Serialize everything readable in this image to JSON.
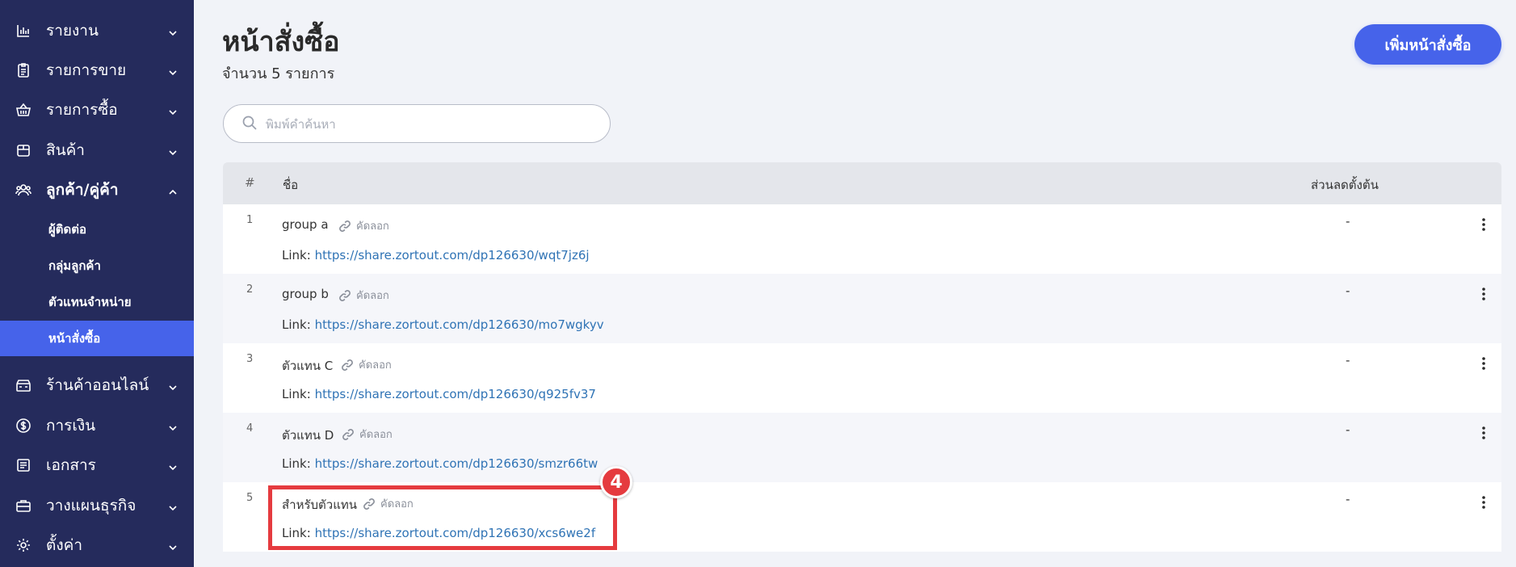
{
  "sidebar": {
    "items": [
      {
        "label": "รายงาน",
        "icon": "chart-icon"
      },
      {
        "label": "รายการขาย",
        "icon": "clipboard-icon"
      },
      {
        "label": "รายการซื้อ",
        "icon": "basket-icon"
      },
      {
        "label": "สินค้า",
        "icon": "box-icon"
      },
      {
        "label": "ลูกค้า/คู่ค้า",
        "icon": "users-icon"
      },
      {
        "label": "ร้านค้าออนไลน์",
        "icon": "shop-icon"
      },
      {
        "label": "การเงิน",
        "icon": "dollar-icon"
      },
      {
        "label": "เอกสาร",
        "icon": "document-icon"
      },
      {
        "label": "วางแผนธุรกิจ",
        "icon": "briefcase-icon"
      },
      {
        "label": "ตั้งค่า",
        "icon": "gear-icon"
      }
    ],
    "subitems": [
      {
        "label": "ผู้ติดต่อ"
      },
      {
        "label": "กลุ่มลูกค้า"
      },
      {
        "label": "ตัวแทนจำหน่าย"
      },
      {
        "label": "หน้าสั่งซื้อ",
        "active": true
      }
    ]
  },
  "header": {
    "title": "หน้าสั่งซื้อ",
    "count_text": "จำนวน 5 รายการ",
    "add_button": "เพิ่มหน้าสั่งซื้อ"
  },
  "search": {
    "placeholder": "พิมพ์คำค้นหา"
  },
  "table": {
    "headers": {
      "num": "#",
      "name": "ชื่อ",
      "discount": "ส่วนลดตั้งต้น"
    },
    "rows": [
      {
        "num": "1",
        "name": "group a",
        "copy": "คัดลอก",
        "link_label": "Link:",
        "url": "https://share.zortout.com/dp126630/wqt7jz6j",
        "discount": "-"
      },
      {
        "num": "2",
        "name": "group b",
        "copy": "คัดลอก",
        "link_label": "Link:",
        "url": "https://share.zortout.com/dp126630/mo7wgkyv",
        "discount": "-"
      },
      {
        "num": "3",
        "name": "ตัวแทน C",
        "copy": "คัดลอก",
        "link_label": "Link:",
        "url": "https://share.zortout.com/dp126630/q925fv37",
        "discount": "-"
      },
      {
        "num": "4",
        "name": "ตัวแทน D",
        "copy": "คัดลอก",
        "link_label": "Link:",
        "url": "https://share.zortout.com/dp126630/smzr66tw",
        "discount": "-"
      },
      {
        "num": "5",
        "name": "สำหรับตัวแทน",
        "copy": "คัดลอก",
        "link_label": "Link:",
        "url": "https://share.zortout.com/dp126630/xcs6we2f",
        "discount": "-"
      }
    ]
  },
  "annotation": {
    "step": "4"
  },
  "colors": {
    "sidebar_bg": "#252b5c",
    "accent": "#4663ea",
    "link": "#2f73b5",
    "highlight": "#e53b3f"
  }
}
